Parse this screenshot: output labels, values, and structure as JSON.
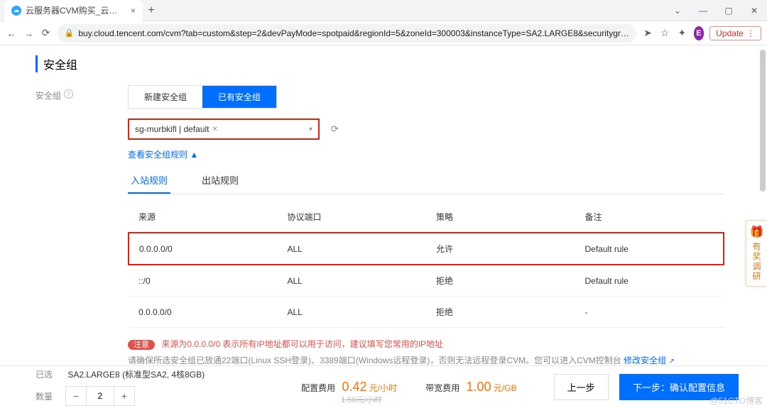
{
  "browser": {
    "tab_title": "云服务器CVM购买_云服务器CV…",
    "url": "buy.cloud.tencent.com/cvm?tab=custom&step=2&devPayMode=spotpaid&regionId=5&zoneId=300003&instanceType=SA2.LARGE8&securitygr…",
    "new_tab": "+",
    "win_min": "—",
    "win_max": "▢",
    "win_close": "✕",
    "ext_badge": "E",
    "update_label": "Update"
  },
  "section": {
    "title": "安全组"
  },
  "form": {
    "label": "安全组",
    "tabs": [
      "新建安全组",
      "已有安全组"
    ],
    "active_tab_index": 1,
    "selected_chip": "sg-murbkifl | default",
    "view_rules_link": "查看安全组规则 ▲",
    "rule_tabs": [
      "入站规则",
      "出站规则"
    ],
    "active_rule_tab_index": 0
  },
  "table": {
    "headers": [
      "来源",
      "协议端口",
      "策略",
      "备注"
    ],
    "rows": [
      {
        "source": "0.0.0.0/0",
        "port": "ALL",
        "policy": "允许",
        "note": "Default rule",
        "highlight": true
      },
      {
        "source": "::/0",
        "port": "ALL",
        "policy": "拒绝",
        "note": "Default rule",
        "highlight": false
      },
      {
        "source": "0.0.0.0/0",
        "port": "ALL",
        "policy": "拒绝",
        "note": "-",
        "highlight": false
      }
    ]
  },
  "notes": {
    "warn_badge": "注意",
    "warn_text": "来源为0.0.0.0/0 表示所有IP地址都可以用于访问，建议填写您常用的IP地址",
    "hint_prefix": "请确保所选安全组已放通22端口(Linux SSH登录)、3389端口(Windows远程登录)，否则无法远程登录CVM。您可以进入CVM控制台 ",
    "hint_link": "修改安全组"
  },
  "footer": {
    "selected_label": "已选",
    "selected_value": "SA2.LARGE8 (标准型SA2, 4核8GB)",
    "qty_label": "数量",
    "qty_value": "2",
    "config_fee_label": "配置费用",
    "config_fee_value": "0.42",
    "config_fee_unit": "元/小时",
    "config_fee_old": "1.50元/小时",
    "bw_fee_label": "带宽费用",
    "bw_fee_value": "1.00",
    "bw_fee_unit": "元/GB",
    "prev_btn": "上一步",
    "next_btn": "下一步：确认配置信息"
  },
  "side_promo": "有奖调研",
  "watermark": "@51CTO博客"
}
